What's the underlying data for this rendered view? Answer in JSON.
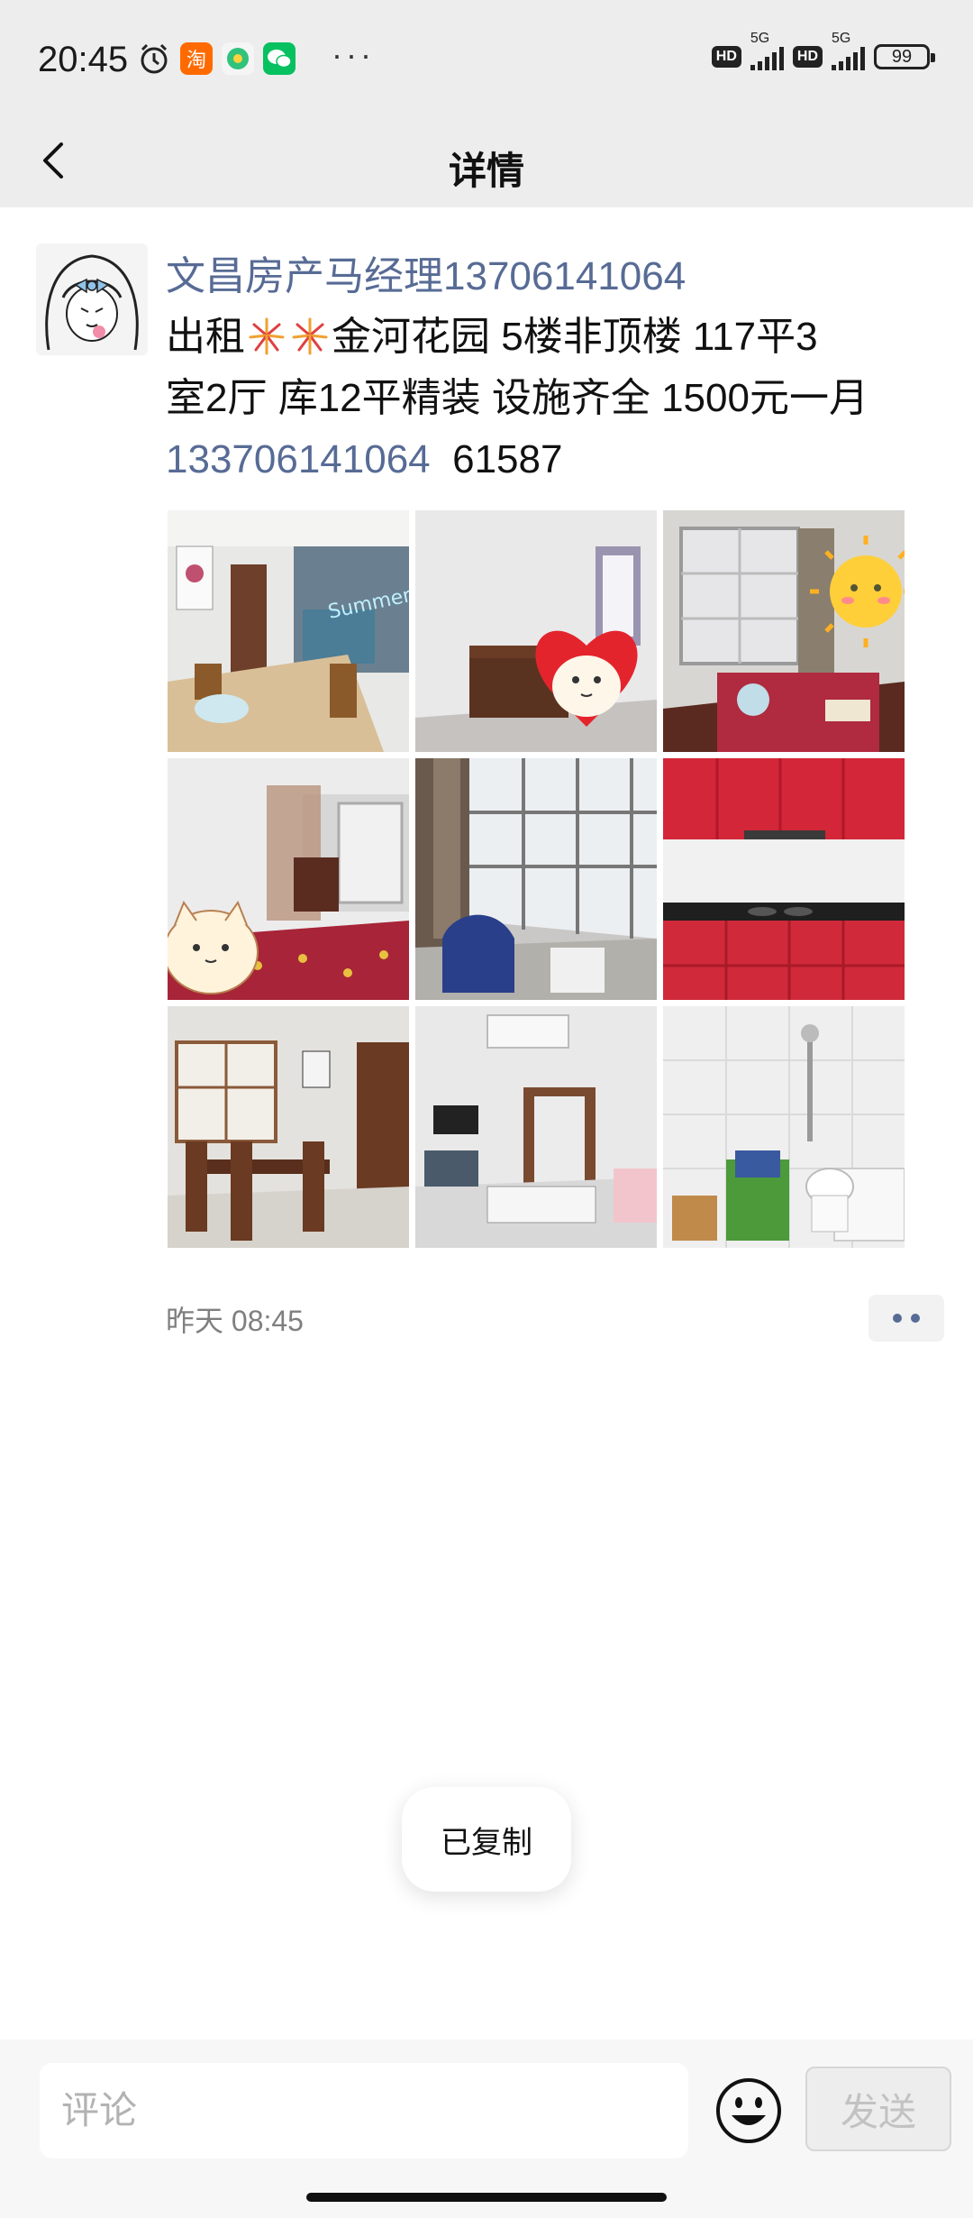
{
  "status_bar": {
    "time": "20:45",
    "network_1": "5G",
    "network_2": "5G",
    "hd_1": "HD",
    "hd_2": "HD",
    "battery": "99",
    "more_dots": "···",
    "icons": [
      "alarm-icon",
      "taobao-icon",
      "qq-music-icon",
      "wechat-icon"
    ]
  },
  "nav": {
    "title": "详情"
  },
  "post": {
    "author": "文昌房产马经理13706141064",
    "line1_a": "出租",
    "line1_b": "金河花园 5楼非顶楼 117平3",
    "line2": "室2厅 库12平精装 设施齐全 1500元一月",
    "phone": "133706141064",
    "code": "61587",
    "time": "昨天 08:45",
    "photos": [
      {
        "name": "dining-room-photo",
        "sticker_text": "Summer Vibe"
      },
      {
        "name": "bedroom-desk-photo"
      },
      {
        "name": "bedroom-window-photo"
      },
      {
        "name": "bedroom-bed-photo"
      },
      {
        "name": "sunroom-photo"
      },
      {
        "name": "kitchen-photo"
      },
      {
        "name": "dining-table-photo"
      },
      {
        "name": "living-room-photo"
      },
      {
        "name": "bathroom-photo"
      }
    ]
  },
  "toast": {
    "text": "已复制"
  },
  "comment": {
    "placeholder": "评论",
    "send_label": "发送"
  },
  "colors": {
    "link": "#576b95",
    "bar_bg": "#ededed"
  }
}
